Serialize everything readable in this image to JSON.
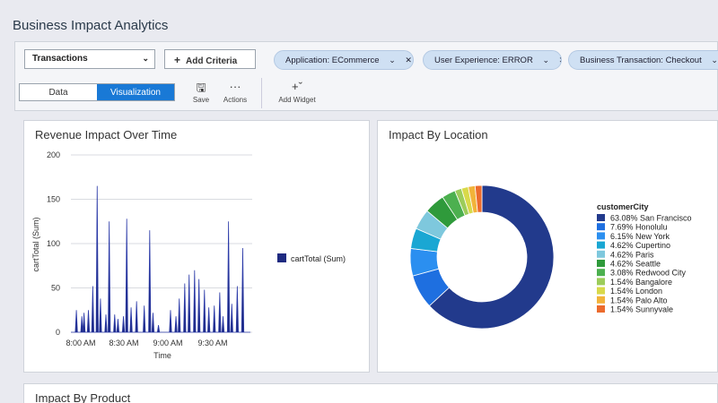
{
  "app": {
    "title": "Business Impact Analytics"
  },
  "toolbar": {
    "select_value": "Transactions",
    "add_criteria": "Add Criteria",
    "filters": [
      {
        "label": "Application: ECommerce"
      },
      {
        "label": "User Experience: ERROR"
      },
      {
        "label": "Business Transaction: Checkout"
      }
    ],
    "tabs": {
      "data": "Data",
      "visualization": "Visualization"
    },
    "save": "Save",
    "actions": "Actions",
    "add_widget": "Add Widget"
  },
  "revenue_panel": {
    "title": "Revenue Impact Over Time"
  },
  "location_panel": {
    "title": "Impact By Location"
  },
  "product_panel": {
    "title": "Impact By Product"
  },
  "colors": {
    "accent": "#1979d6",
    "series": "#1e2a80",
    "chip": "#cfe0f3"
  },
  "chart_data": [
    {
      "type": "area",
      "title": "Revenue Impact Over Time",
      "xlabel": "Time",
      "ylabel": "cartTotal (Sum)",
      "ylim": [
        0,
        200
      ],
      "y_ticks": [
        0,
        50,
        100,
        150,
        200
      ],
      "x_ticks": [
        "8:00 AM",
        "8:30 AM",
        "9:00 AM",
        "9:30 AM"
      ],
      "legend": "right",
      "grid": true,
      "series": [
        {
          "name": "cartTotal (Sum)",
          "x_range_minutes_from_first_tick": [
            -5,
            55
          ],
          "values": [
            0,
            0,
            0,
            0,
            0,
            25,
            0,
            0,
            0,
            0,
            18,
            0,
            22,
            0,
            0,
            0,
            25,
            0,
            0,
            0,
            52,
            0,
            0,
            0,
            165,
            0,
            0,
            38,
            0,
            0,
            0,
            0,
            20,
            0,
            0,
            125,
            0,
            0,
            0,
            0,
            20,
            0,
            0,
            15,
            0,
            0,
            0,
            0,
            18,
            0,
            0,
            128,
            0,
            0,
            0,
            28,
            0,
            0,
            0,
            0,
            35,
            0,
            0,
            0,
            0,
            0,
            0,
            30,
            0,
            0,
            0,
            0,
            115,
            0,
            0,
            22,
            0,
            0,
            0,
            0,
            8,
            0,
            0,
            0,
            0,
            0,
            0,
            0,
            0,
            0,
            0,
            25,
            0,
            0,
            0,
            0,
            18,
            0,
            0,
            38,
            0,
            0,
            0,
            0,
            55,
            0,
            0,
            0,
            65,
            0,
            0,
            0,
            0,
            70,
            0,
            0,
            0,
            60,
            0,
            0,
            0,
            0,
            48,
            0,
            0,
            0,
            28,
            0,
            0,
            0,
            0,
            30,
            0,
            0,
            0,
            0,
            45,
            0,
            0,
            18,
            0,
            0,
            0,
            0,
            125,
            0,
            0,
            32,
            0,
            0,
            0,
            0,
            52,
            0,
            0,
            0,
            0,
            95,
            0,
            0,
            0,
            0,
            0,
            0,
            0
          ]
        }
      ]
    },
    {
      "type": "pie",
      "title": "Impact By Location",
      "legend_title": "customerCity",
      "legend": "right",
      "slices": [
        {
          "label": "63.08% San Francisco",
          "value": 63.08,
          "color": "#223a8c"
        },
        {
          "label": "7.69% Honolulu",
          "value": 7.69,
          "color": "#1e6fe0"
        },
        {
          "label": "6.15% New York",
          "value": 6.15,
          "color": "#2b8ff0"
        },
        {
          "label": "4.62% Cupertino",
          "value": 4.62,
          "color": "#1aa7d3"
        },
        {
          "label": "4.62% Paris",
          "value": 4.62,
          "color": "#7ec8dd"
        },
        {
          "label": "4.62% Seattle",
          "value": 4.62,
          "color": "#2f9a3b"
        },
        {
          "label": "3.08% Redwood City",
          "value": 3.08,
          "color": "#4cb04f"
        },
        {
          "label": "1.54% Bangalore",
          "value": 1.54,
          "color": "#9ccc5a"
        },
        {
          "label": "1.54% London",
          "value": 1.54,
          "color": "#d8d94a"
        },
        {
          "label": "1.54% Palo Alto",
          "value": 1.54,
          "color": "#f2b33a"
        },
        {
          "label": "1.54% Sunnyvale",
          "value": 1.54,
          "color": "#ec6b2d"
        }
      ]
    }
  ]
}
